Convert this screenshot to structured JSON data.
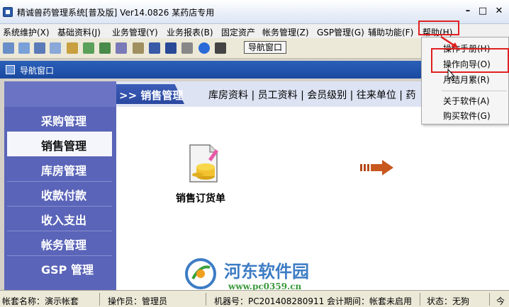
{
  "window": {
    "title": "精诚兽药管理系统[普及版] Ver14.0826    某药店专用",
    "minimize": "–",
    "maximize": "□",
    "close": "✕"
  },
  "menu": [
    "系统维护(X)",
    "基础资料(J)",
    "业务管理(Y)",
    "业务报表(B)",
    "固定资产",
    "帐务管理(Z)",
    "GSP管理(G)",
    "辅助功能(F)",
    "帮助(H)"
  ],
  "toolbar": {
    "nav_button": "导航窗口",
    "icons": [
      "grid-icon",
      "calculator-icon",
      "copy-icon",
      "document-icon",
      "tools-icon",
      "chart-icon",
      "people-icon",
      "database-icon",
      "print-icon",
      "save-icon",
      "floppy-icon",
      "printer-icon",
      "help-icon",
      "exit-icon"
    ]
  },
  "nav_window": {
    "title": "导航窗口",
    "sidebar": [
      {
        "label": "采购管理",
        "active": false
      },
      {
        "label": "销售管理",
        "active": true
      },
      {
        "label": "库房管理",
        "active": false
      },
      {
        "label": "收款付款",
        "active": false
      },
      {
        "label": "收入支出",
        "active": false
      },
      {
        "label": "帐务管理",
        "active": false
      },
      {
        "label": "GSP 管理",
        "active": false
      }
    ],
    "section_title": ">> 销售管理",
    "header_links": "库房资料 | 员工资料 | 会员级别 | 往来单位 | 药",
    "content_item": "销售订货单"
  },
  "help_menu": {
    "items": [
      "操作手册(H)",
      "操作向导(O)",
      "月结月累(R)",
      "关于软件(A)",
      "购买软件(G)"
    ],
    "highlighted_index": 1
  },
  "watermark": {
    "name": "河东软件园",
    "url": "www.pc0359.cn"
  },
  "status": {
    "account": "帐套名称：演示帐套",
    "operator": "操作员：管理员",
    "machine": "机器号：PC201408280911 会计期间：帐套未启用",
    "state": "状态：无狗",
    "more": "今"
  },
  "colors": {
    "sidebar": "#5a64b8",
    "nav_title": "#1a4aa0",
    "highlight_red": "#e02020"
  }
}
